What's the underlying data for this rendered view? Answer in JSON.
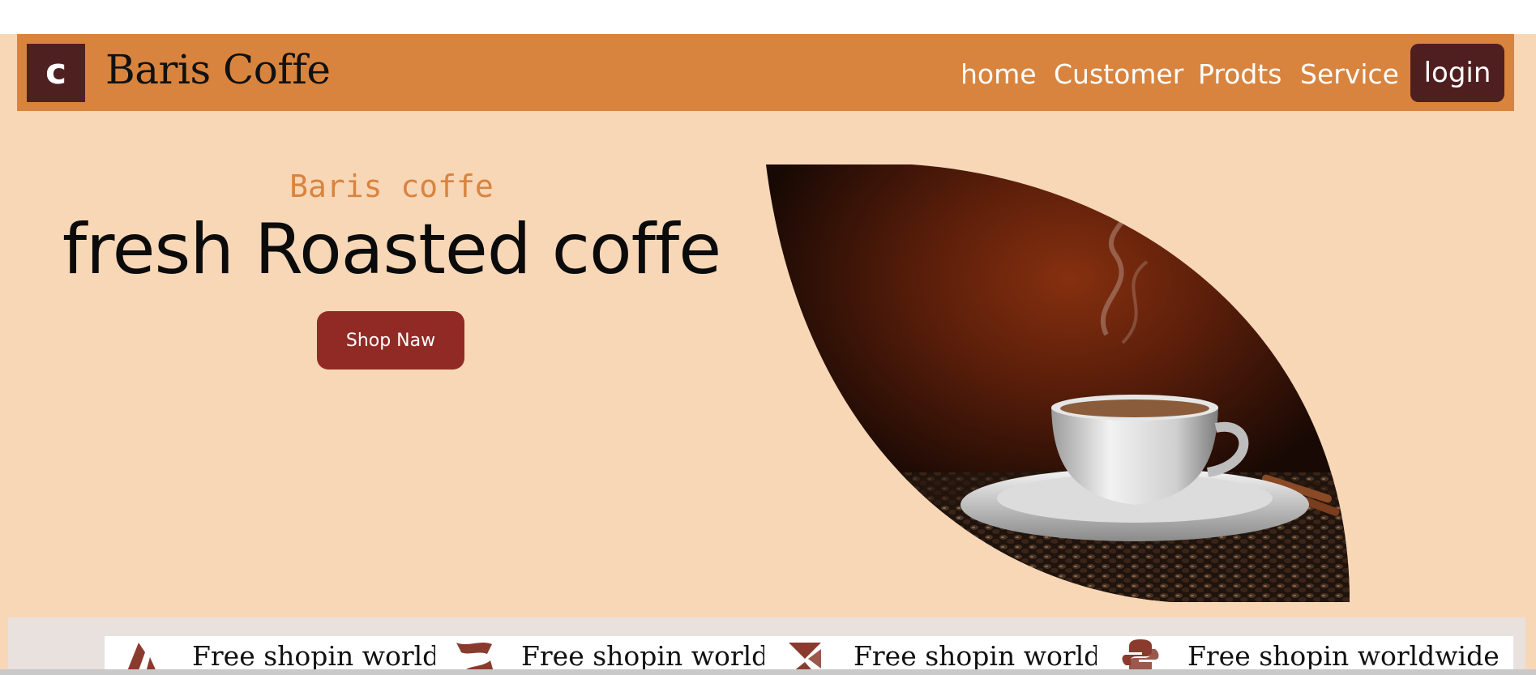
{
  "header": {
    "logo_letter": "c",
    "brand": "Baris Coffe",
    "nav": {
      "home": "home",
      "customer": "Customer",
      "products": "Prodts",
      "service": "Service",
      "login": "login"
    }
  },
  "hero": {
    "subtitle": "Baris coffe",
    "title": "fresh Roasted coffe",
    "cta": "Shop Naw",
    "image": "coffee-cup-photo"
  },
  "features_strip": {
    "items": [
      {
        "icon": "brand-icon-1",
        "text": "Free shopin worldwide"
      },
      {
        "icon": "brand-icon-2",
        "text": "Free shopin worldwide"
      },
      {
        "icon": "brand-icon-3",
        "text": "Free shopin worldwide"
      },
      {
        "icon": "python-icon",
        "text": "Free shopin worldwide"
      }
    ]
  },
  "colors": {
    "background": "#f8d7b7",
    "navbar": "#d8843f",
    "dark_brown": "#4f1f1f",
    "button_red": "#912a25",
    "icon_brown": "#8a3b2e"
  }
}
